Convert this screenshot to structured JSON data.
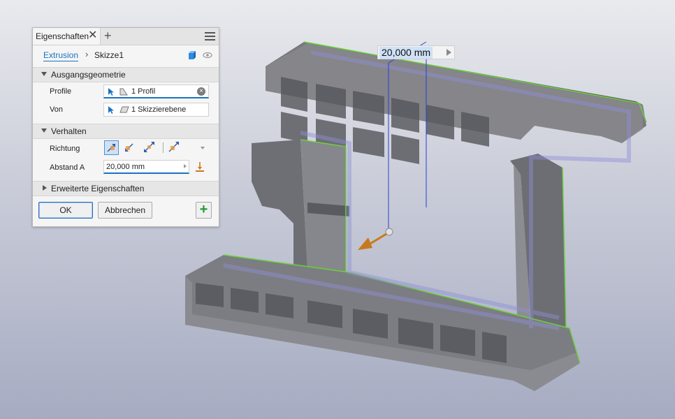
{
  "panel": {
    "tab_label": "Eigenschaften",
    "close_icon": "close-icon",
    "add_icon": "plus-icon",
    "menu_icon": "hamburger-menu-icon",
    "breadcrumb": {
      "feature": "Extrusion",
      "separator": "›",
      "sketch": "Skizze1"
    },
    "sections": {
      "input_geometry": "Ausgangsgeometrie",
      "behavior": "Verhalten",
      "advanced": "Erweiterte Eigenschaften"
    },
    "fields": {
      "profiles_label": "Profile",
      "profiles_value": "1 Profil",
      "from_label": "Von",
      "from_value": "1 Skizzierebene",
      "direction_label": "Richtung",
      "distance_label": "Abstand A",
      "distance_value": "20,000 mm"
    },
    "buttons": {
      "ok": "OK",
      "cancel": "Abbrechen",
      "add": "+"
    }
  },
  "viewport": {
    "dimension_value": "20,000 mm",
    "colors": {
      "part": "#7f8085",
      "edge_highlight": "#6ad13a",
      "dimension": "#2c3fd1",
      "manipulator": "#c8791c"
    }
  }
}
